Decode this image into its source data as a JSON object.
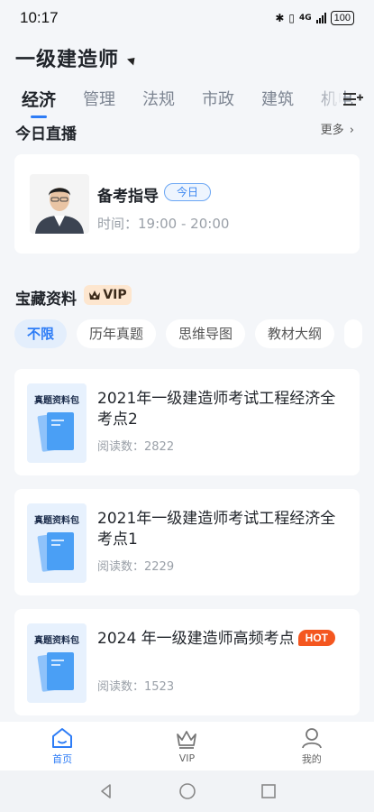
{
  "status": {
    "time": "10:17",
    "network": "4G",
    "battery": "100"
  },
  "header": {
    "title": "一级建造师"
  },
  "tabs": [
    {
      "label": "经济",
      "active": true
    },
    {
      "label": "管理"
    },
    {
      "label": "法规"
    },
    {
      "label": "市政"
    },
    {
      "label": "建筑"
    },
    {
      "label": "机电"
    }
  ],
  "live": {
    "section_title": "今日直播",
    "more": "更多",
    "title": "备考指导",
    "badge": "今日",
    "time": "时间：19:00 - 20:00"
  },
  "treasure": {
    "section_title": "宝藏资料",
    "vip_label": "VIP",
    "filters": [
      "不限",
      "历年真题",
      "思维导图",
      "教材大纲"
    ],
    "items": [
      {
        "cover_label": "真题资料包",
        "title": "2021年一级建造师考试工程经济全考点2",
        "reads": "阅读数：2822"
      },
      {
        "cover_label": "真题资料包",
        "title": "2021年一级建造师考试工程经济全考点1",
        "reads": "阅读数：2229"
      },
      {
        "cover_label": "真题资料包",
        "title": "2024 年一级建造师高频考点",
        "hot": "HOT",
        "reads": "阅读数：1523"
      }
    ]
  },
  "nav": [
    {
      "label": "首页",
      "icon": "home-icon",
      "active": true
    },
    {
      "label": "VIP",
      "icon": "crown-icon"
    },
    {
      "label": "我的",
      "icon": "user-icon"
    }
  ],
  "colors": {
    "accent": "#2d7cf6",
    "hot": "#f4561f",
    "vip_bg": "#fde6cf"
  }
}
